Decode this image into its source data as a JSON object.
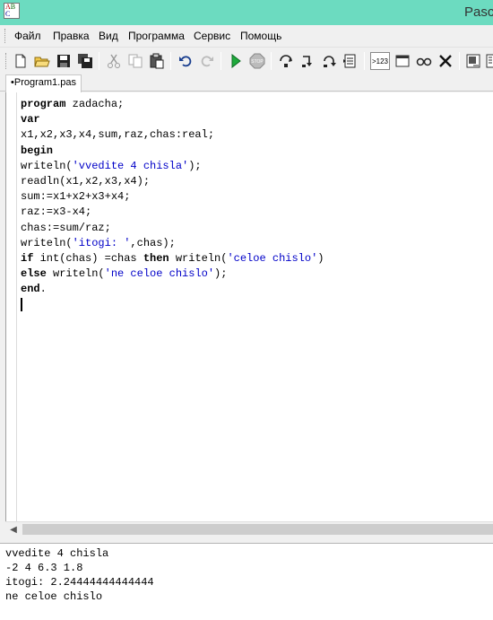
{
  "window": {
    "title": "Pasca"
  },
  "app_icon": {
    "letters": [
      "A",
      "B",
      "C"
    ]
  },
  "menu": {
    "items": [
      "Файл",
      "Правка",
      "Вид",
      "Программа",
      "Сервис",
      "Помощь"
    ]
  },
  "toolbar": {
    "icons": [
      "new-file-icon",
      "open-folder-icon",
      "save-icon",
      "save-all-icon",
      "cut-icon",
      "copy-icon",
      "paste-icon",
      "undo-icon",
      "redo-icon",
      "run-icon",
      "stop-icon",
      "step-over-icon",
      "step-into-icon",
      "step-out-icon",
      "watch-icon",
      "output-numbers-icon",
      "window-icon",
      "glasses-icon",
      "close-x-icon",
      "debug-icon",
      "compile-icon"
    ],
    "num_button_label": ">123",
    "stop_label": "STOP"
  },
  "tabs": [
    {
      "label": "•Program1.pas",
      "active": true
    }
  ],
  "editor": {
    "lines": [
      [
        {
          "t": "program",
          "k": "kw"
        },
        {
          "t": " zadacha;",
          "k": ""
        }
      ],
      [
        {
          "t": "var",
          "k": "kw"
        }
      ],
      [
        {
          "t": "x1,x2,x3,x4,sum,raz,chas:real;",
          "k": ""
        }
      ],
      [
        {
          "t": "begin",
          "k": "kw"
        }
      ],
      [
        {
          "t": "writeln(",
          "k": ""
        },
        {
          "t": "'vvedite 4 chisla'",
          "k": "str"
        },
        {
          "t": ");",
          "k": ""
        }
      ],
      [
        {
          "t": "readln(x1,x2,x3,x4);",
          "k": ""
        }
      ],
      [
        {
          "t": "sum:=x1+x2+x3+x4;",
          "k": ""
        }
      ],
      [
        {
          "t": "raz:=x3-x4;",
          "k": ""
        }
      ],
      [
        {
          "t": "chas:=sum/raz;",
          "k": ""
        }
      ],
      [
        {
          "t": "writeln(",
          "k": ""
        },
        {
          "t": "'itogi: '",
          "k": "str"
        },
        {
          "t": ",chas);",
          "k": ""
        }
      ],
      [
        {
          "t": "if",
          "k": "kw"
        },
        {
          "t": " int(chas) =chas ",
          "k": ""
        },
        {
          "t": "then",
          "k": "kw"
        },
        {
          "t": " writeln(",
          "k": ""
        },
        {
          "t": "'celoe chislo'",
          "k": "str"
        },
        {
          "t": ")",
          "k": ""
        }
      ],
      [
        {
          "t": "else",
          "k": "kw"
        },
        {
          "t": " writeln(",
          "k": ""
        },
        {
          "t": "'ne celoe chislo'",
          "k": "str"
        },
        {
          "t": ");",
          "k": ""
        }
      ],
      [
        {
          "t": "end",
          "k": "kw"
        },
        {
          "t": ".",
          "k": ""
        }
      ]
    ]
  },
  "output": {
    "lines": [
      "vvedite 4 chisla",
      "-2 4 6.3 1.8",
      "itogi: 2.24444444444444",
      "ne celoe chislo"
    ]
  }
}
